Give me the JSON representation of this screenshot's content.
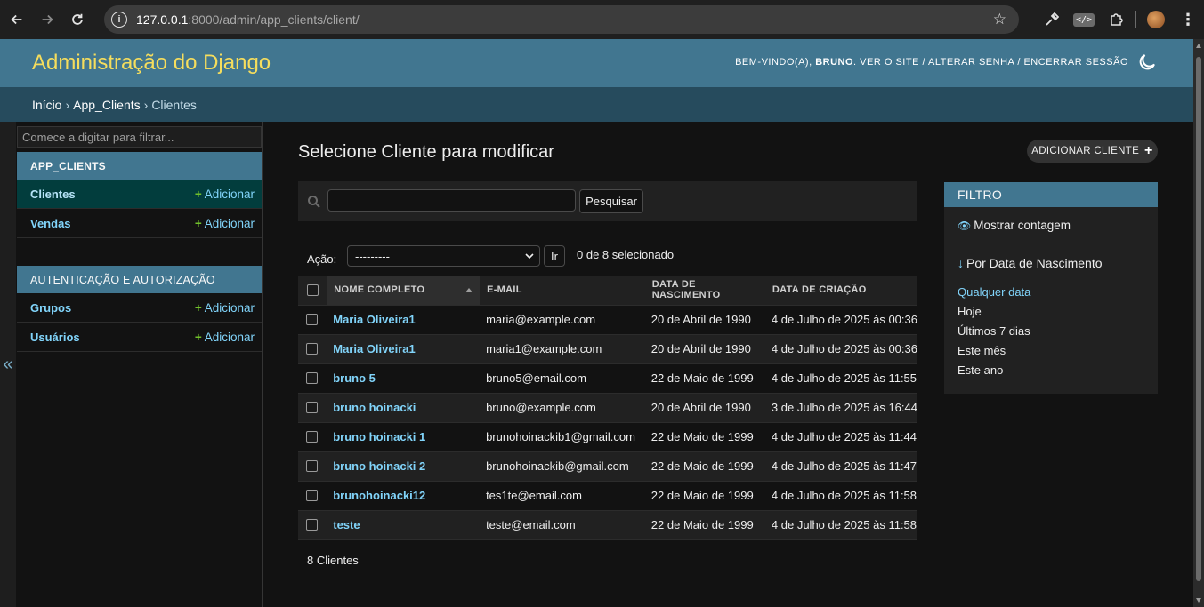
{
  "browser": {
    "url_host": "127.0.0.1",
    "url_rest": ":8000/admin/app_clients/client/"
  },
  "header": {
    "site_name": "Administração do Django",
    "welcome": "BEM-VINDO(A),",
    "username": "BRUNO",
    "view_site": "VER O SITE",
    "change_password": "ALTERAR SENHA",
    "logout": "ENCERRAR SESSÃO",
    "slash": "/"
  },
  "breadcrumbs": {
    "home": "Início",
    "app": "App_Clients",
    "current": "Clientes",
    "sep": "›"
  },
  "sidebar": {
    "filter_placeholder": "Comece a digitar para filtrar...",
    "toggle": "«",
    "apps": [
      {
        "caption": "APP_CLIENTS",
        "models": [
          {
            "name": "Clientes",
            "add": "Adicionar"
          },
          {
            "name": "Vendas",
            "add": "Adicionar"
          }
        ]
      },
      {
        "caption": "AUTENTICAÇÃO E AUTORIZAÇÃO",
        "models": [
          {
            "name": "Grupos",
            "add": "Adicionar"
          },
          {
            "name": "Usuários",
            "add": "Adicionar"
          }
        ]
      }
    ]
  },
  "main": {
    "title": "Selecione Cliente para modificar",
    "add_button": "ADICIONAR CLIENTE",
    "search_button": "Pesquisar",
    "action_label": "Ação:",
    "action_selected": "---------",
    "go_button": "Ir",
    "counter": "0 de 8 selecionado",
    "columns": [
      "NOME COMPLETO",
      "E-MAIL",
      "DATA DE NASCIMENTO",
      "DATA DE CRIAÇÃO"
    ],
    "rows": [
      {
        "name": "Maria Oliveira1",
        "email": "maria@example.com",
        "birth": "20 de Abril de 1990",
        "created": "4 de Julho de 2025 às 00:36"
      },
      {
        "name": "Maria Oliveira1",
        "email": "maria1@example.com",
        "birth": "20 de Abril de 1990",
        "created": "4 de Julho de 2025 às 00:36"
      },
      {
        "name": "bruno 5",
        "email": "bruno5@email.com",
        "birth": "22 de Maio de 1999",
        "created": "4 de Julho de 2025 às 11:55"
      },
      {
        "name": "bruno hoinacki",
        "email": "bruno@example.com",
        "birth": "20 de Abril de 1990",
        "created": "3 de Julho de 2025 às 16:44"
      },
      {
        "name": "bruno hoinacki 1",
        "email": "brunohoinackib1@gmail.com",
        "birth": "22 de Maio de 1999",
        "created": "4 de Julho de 2025 às 11:44"
      },
      {
        "name": "bruno hoinacki 2",
        "email": "brunohoinackib@gmail.com",
        "birth": "22 de Maio de 1999",
        "created": "4 de Julho de 2025 às 11:47"
      },
      {
        "name": "brunohoinacki12",
        "email": "tes1te@email.com",
        "birth": "22 de Maio de 1999",
        "created": "4 de Julho de 2025 às 11:58"
      },
      {
        "name": "teste",
        "email": "teste@email.com",
        "birth": "22 de Maio de 1999",
        "created": "4 de Julho de 2025 às 11:58"
      }
    ],
    "paginator": "8 Clientes"
  },
  "filter": {
    "title": "FILTRO",
    "show_count": "Mostrar contagem",
    "section": "Por Data de Nascimento",
    "options": [
      "Qualquer data",
      "Hoje",
      "Últimos 7 dias",
      "Este mês",
      "Este ano"
    ]
  },
  "colors": {
    "header_bg": "#417690",
    "brand": "#f5dd5d",
    "link": "#81d4fa",
    "add_plus": "#70bf2b"
  }
}
